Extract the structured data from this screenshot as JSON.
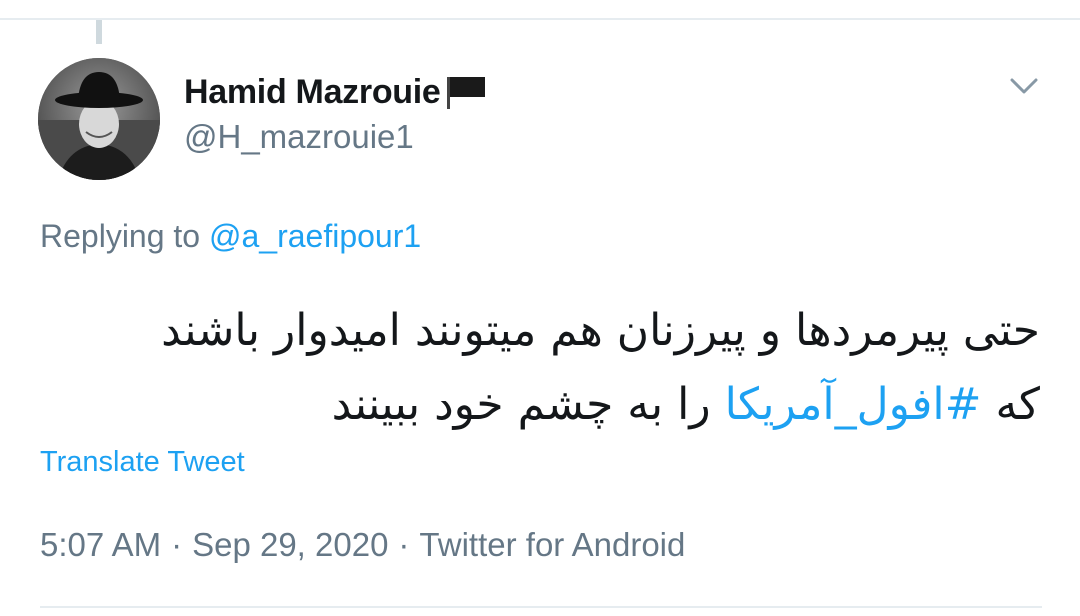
{
  "tweet": {
    "display_name": "Hamid Mazrouie",
    "handle": "@H_mazrouie1",
    "name_flag_icon": "black-flag-icon",
    "menu_icon": "chevron-down-icon",
    "replying_prefix": "Replying to",
    "replying_to": "@a_raefipour1",
    "text_line1": "حتی پیرمردها و پیرزنان هم میتونند امیدوار باشند",
    "text_line2_prefix": "که",
    "hashtag": "#افول_آمریکا",
    "text_line2_suffix": "را به چشم خود ببینند",
    "translate_label": "Translate Tweet",
    "time": "5:07 AM",
    "date": "Sep 29, 2020",
    "source": "Twitter for Android",
    "separator": "·"
  },
  "colors": {
    "link": "#1da1f2",
    "secondary_text": "#657786",
    "primary_text": "#14171a",
    "border": "#e6ecf0"
  }
}
